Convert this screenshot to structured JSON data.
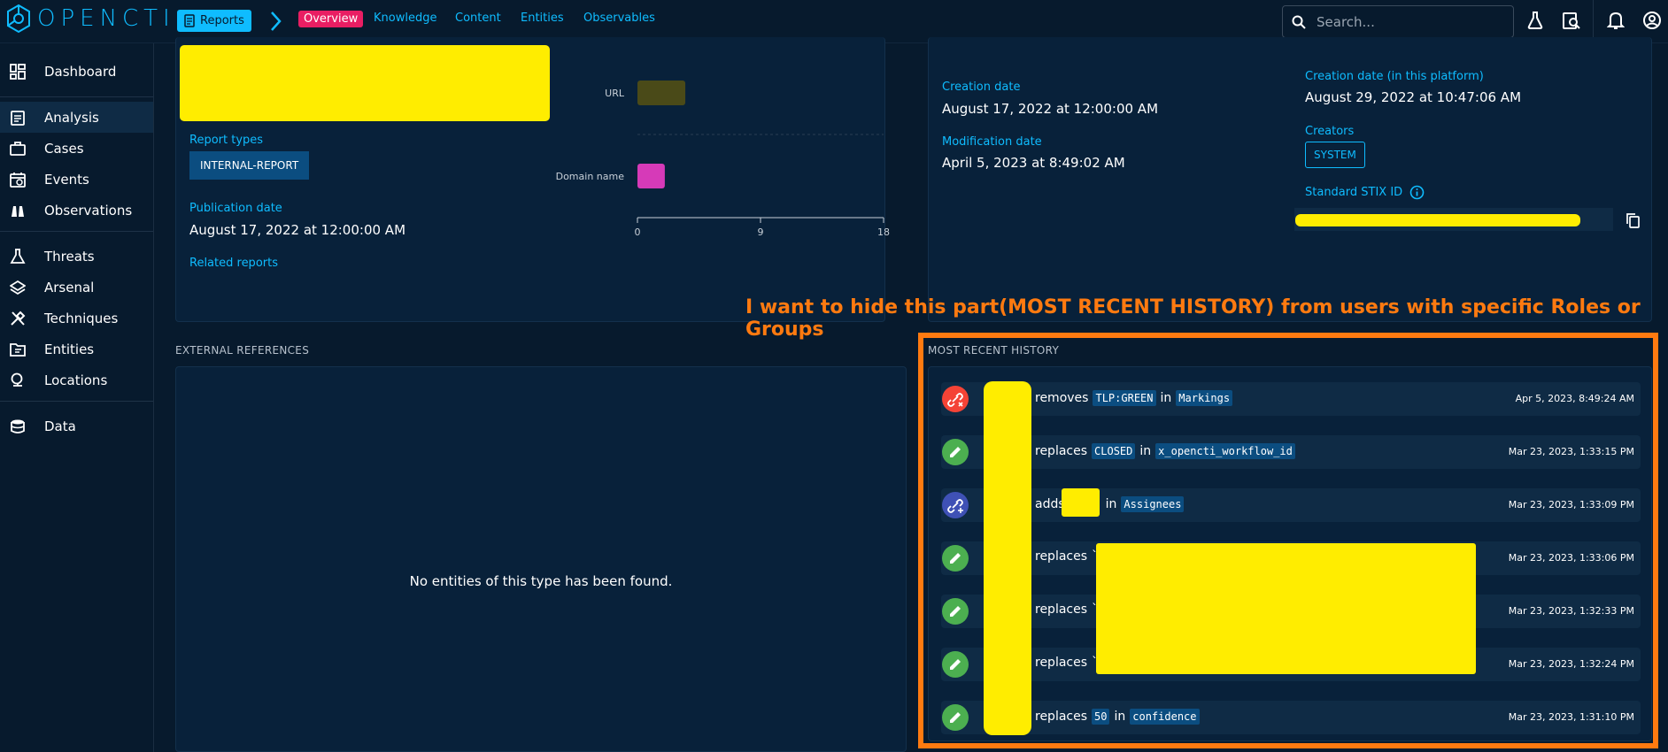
{
  "app": {
    "logo_text": "OPENCTI"
  },
  "topbar": {
    "breadcrumb": "Reports",
    "tabs": [
      "Overview",
      "Knowledge",
      "Content",
      "Entities",
      "Observables"
    ],
    "search_placeholder": "Search..."
  },
  "sidebar": {
    "items": [
      {
        "label": "Dashboard",
        "icon": "dashboard-icon"
      },
      {
        "label": "Analysis",
        "icon": "clipboard-icon"
      },
      {
        "label": "Cases",
        "icon": "briefcase-icon"
      },
      {
        "label": "Events",
        "icon": "calendar-icon"
      },
      {
        "label": "Observations",
        "icon": "binoculars-icon"
      },
      {
        "label": "Threats",
        "icon": "flask-icon"
      },
      {
        "label": "Arsenal",
        "icon": "layers-icon"
      },
      {
        "label": "Techniques",
        "icon": "tools-icon"
      },
      {
        "label": "Entities",
        "icon": "folder-icon"
      },
      {
        "label": "Locations",
        "icon": "globe-icon"
      },
      {
        "label": "Data",
        "icon": "database-icon"
      }
    ]
  },
  "details": {
    "report_types_label": "Report types",
    "report_type_value": "INTERNAL-REPORT",
    "publication_date_label": "Publication date",
    "publication_date_value": "August 17, 2022 at 12:00:00 AM",
    "related_reports_label": "Related reports"
  },
  "chart_data": {
    "type": "bar",
    "orientation": "horizontal",
    "categories": [
      "URL",
      "Domain name"
    ],
    "values": [
      3.5,
      2
    ],
    "colors": [
      "#4a4a18",
      "#d63ab8"
    ],
    "xlim": [
      0,
      18
    ],
    "xticks": [
      0,
      9,
      18
    ]
  },
  "meta": {
    "creation_date_label": "Creation date",
    "creation_date_value": "August 17, 2022 at 12:00:00 AM",
    "modification_date_label": "Modification date",
    "modification_date_value": "April 5, 2023 at 8:49:02 AM",
    "platform_date_label": "Creation date (in this platform)",
    "platform_date_value": "August 29, 2022 at 10:47:06 AM",
    "creators_label": "Creators",
    "creator_value": "SYSTEM",
    "stix_label": "Standard STIX ID"
  },
  "external_references": {
    "title": "EXTERNAL REFERENCES",
    "empty_text": "No entities of this type has been found."
  },
  "annotation": {
    "text": "I want to hide this part(MOST RECENT HISTORY) from users with specific Roles or Groups",
    "color": "#ff7a10"
  },
  "history": {
    "title": "MOST RECENT HISTORY",
    "rows": [
      {
        "icon": "link-off-icon",
        "color": "#f44336",
        "action": "removes",
        "value": "TLP:GREEN",
        "in": "in",
        "field": "Markings",
        "date": "Apr 5, 2023, 8:49:24 AM"
      },
      {
        "icon": "pencil-icon",
        "color": "#4caf50",
        "action": "replaces",
        "value": "CLOSED",
        "in": "in",
        "field": "x_opencti_workflow_id",
        "date": "Mar 23, 2023, 1:33:15 PM"
      },
      {
        "icon": "link-plus-icon",
        "color": "#3f51b5",
        "action": "adds",
        "value": "",
        "in": "in",
        "field": "Assignees",
        "date": "Mar 23, 2023, 1:33:09 PM"
      },
      {
        "icon": "pencil-icon",
        "color": "#4caf50",
        "action": "replaces",
        "value": "`",
        "in": "",
        "field": "",
        "date": "Mar 23, 2023, 1:33:06 PM"
      },
      {
        "icon": "pencil-icon",
        "color": "#4caf50",
        "action": "replaces",
        "value": "`",
        "in": "",
        "field": "",
        "date": "Mar 23, 2023, 1:32:33 PM"
      },
      {
        "icon": "pencil-icon",
        "color": "#4caf50",
        "action": "replaces",
        "value": "`",
        "in": "",
        "field": "",
        "date": "Mar 23, 2023, 1:32:24 PM"
      },
      {
        "icon": "pencil-icon",
        "color": "#4caf50",
        "action": "replaces",
        "value": "50",
        "in": "in",
        "field": "confidence",
        "date": "Mar 23, 2023, 1:31:10 PM"
      }
    ]
  }
}
